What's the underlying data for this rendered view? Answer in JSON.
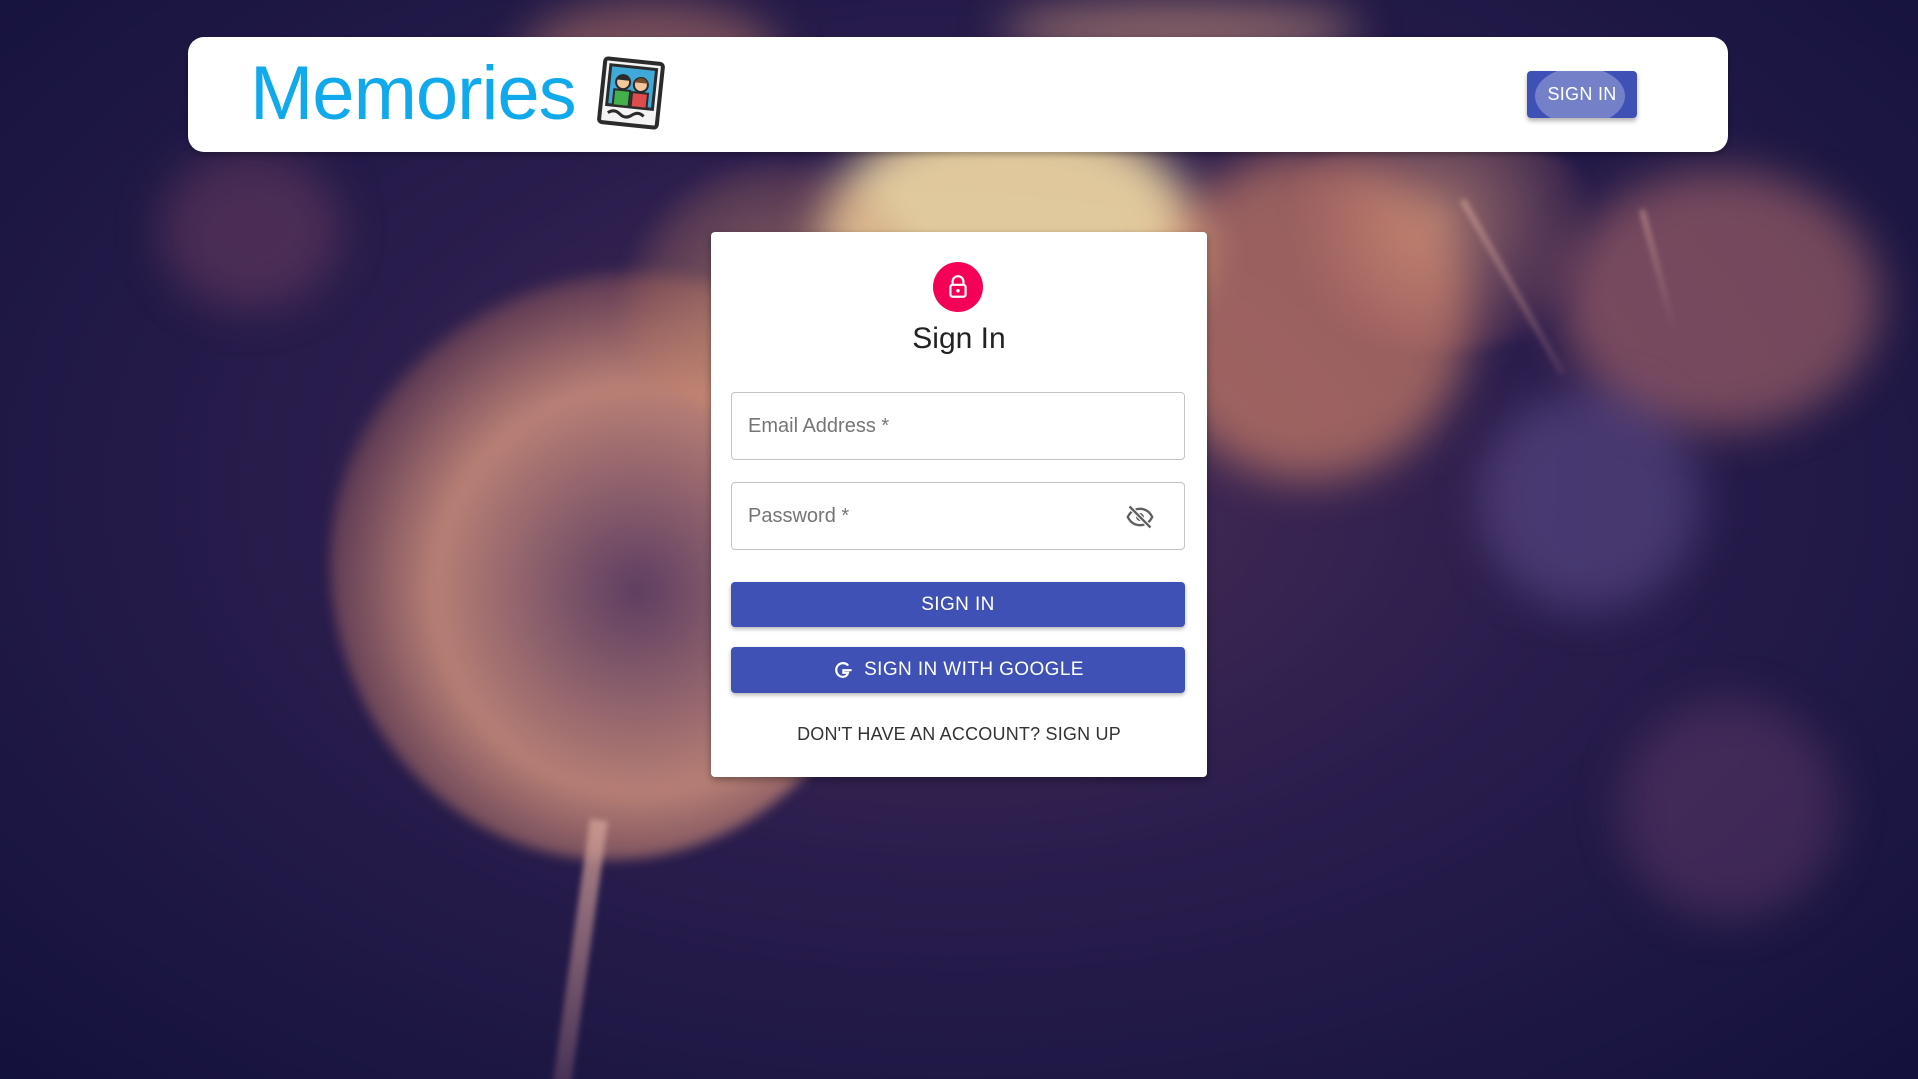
{
  "header": {
    "brand": "Memories",
    "brand_logo_icon": "photo-memories-icon",
    "signin_label": "SIGN IN"
  },
  "signin_card": {
    "lock_icon": "lock-outline-icon",
    "title": "Sign In",
    "email": {
      "placeholder": "Email Address *",
      "value": ""
    },
    "password": {
      "placeholder": "Password *",
      "value": "",
      "visibility_icon": "eye-off-icon"
    },
    "submit_label": "SIGN IN",
    "google_label": "SIGN IN WITH GOOGLE",
    "google_icon": "google-g-icon",
    "signup_link": "DON'T HAVE AN ACCOUNT? SIGN UP"
  },
  "colors": {
    "brand": "#10a9ec",
    "primary": "#3f51b5",
    "avatar": "#f50057",
    "background": "#2a1d4d"
  }
}
